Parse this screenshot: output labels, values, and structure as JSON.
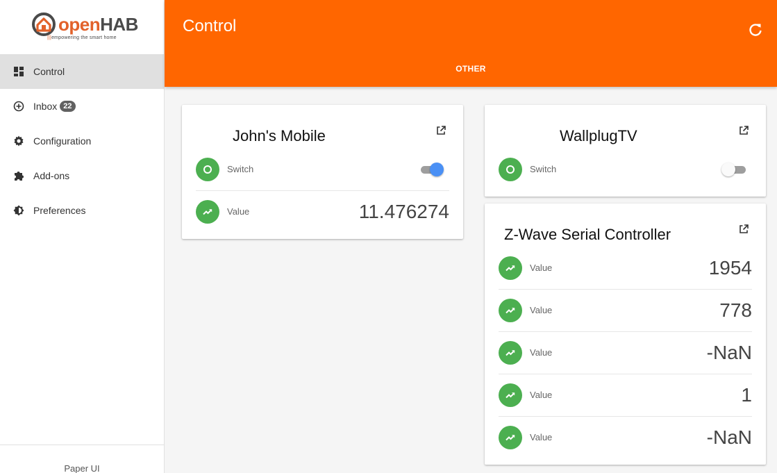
{
  "brand": {
    "logo_open": "open",
    "logo_hab": "HAB",
    "tagline": "empowering the smart home",
    "tagline_dots": "|||",
    "accent_color": "#ff6600",
    "logo_color": "#e2622b"
  },
  "sidebar": {
    "items": [
      {
        "label": "Control",
        "icon": "dashboard-icon",
        "active": true
      },
      {
        "label": "Inbox",
        "icon": "add-circle-icon",
        "badge": "22"
      },
      {
        "label": "Configuration",
        "icon": "gear-icon"
      },
      {
        "label": "Add-ons",
        "icon": "puzzle-icon"
      },
      {
        "label": "Preferences",
        "icon": "brightness-icon"
      }
    ],
    "footer": "Paper UI"
  },
  "header": {
    "title": "Control",
    "tab": "OTHER",
    "refresh_icon": "refresh-icon"
  },
  "cards": {
    "johns_mobile": {
      "title": "John's Mobile",
      "switch_label": "Switch",
      "switch_on": true,
      "value_label": "Value",
      "value": "11.476274"
    },
    "wallplug": {
      "title": "WallplugTV",
      "switch_label": "Switch",
      "switch_on": false
    },
    "zwave": {
      "title": "Z-Wave Serial Controller",
      "rows": [
        {
          "label": "Value",
          "value": "1954"
        },
        {
          "label": "Value",
          "value": "778"
        },
        {
          "label": "Value",
          "value": "-NaN"
        },
        {
          "label": "Value",
          "value": "1"
        },
        {
          "label": "Value",
          "value": "-NaN"
        }
      ]
    }
  },
  "colors": {
    "item_icon_bg": "#4caf50",
    "toggle_on": "#4a90f5",
    "toggle_off_track": "#9e9e9e"
  }
}
